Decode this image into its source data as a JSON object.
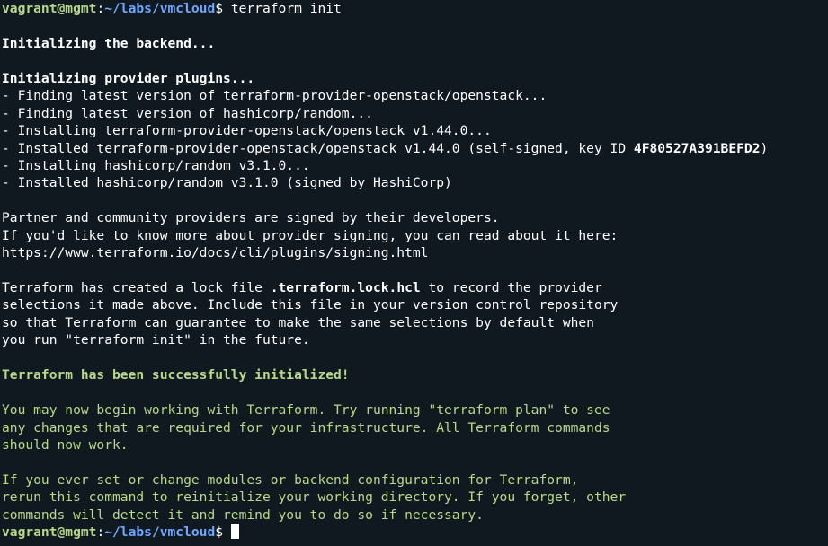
{
  "colors": {
    "background": "#101820",
    "text": "#ffffff",
    "success_green": "#b8d98a",
    "path_blue": "#6ea8ff"
  },
  "prompt": {
    "user_host": "vagrant@mgmt",
    "separator": ":",
    "path": "~/labs/vmcloud",
    "symbol": "$ "
  },
  "command": "terraform init",
  "output": {
    "backend": "Initializing the backend...",
    "providers_heading": "Initializing provider plugins...",
    "find_openstack": "- Finding latest version of terraform-provider-openstack/openstack...",
    "find_random": "- Finding latest version of hashicorp/random...",
    "installing_openstack": "- Installing terraform-provider-openstack/openstack v1.44.0...",
    "installed_openstack_prefix": "- Installed terraform-provider-openstack/openstack v1.44.0 (self-signed, key ID ",
    "installed_openstack_key": "4F80527A391BEFD2",
    "installed_openstack_suffix": ")",
    "installing_random": "- Installing hashicorp/random v3.1.0...",
    "installed_random": "- Installed hashicorp/random v3.1.0 (signed by HashiCorp)",
    "partner_1": "Partner and community providers are signed by their developers.",
    "partner_2": "If you'd like to know more about provider signing, you can read about it here:",
    "partner_3": "https://www.terraform.io/docs/cli/plugins/signing.html",
    "lock_1_prefix": "Terraform has created a lock file ",
    "lock_1_file": ".terraform.lock.hcl",
    "lock_1_suffix": " to record the provider",
    "lock_2": "selections it made above. Include this file in your version control repository",
    "lock_3": "so that Terraform can guarantee to make the same selections by default when",
    "lock_4": "you run \"terraform init\" in the future.",
    "success": "Terraform has been successfully initialized!",
    "next_1": "You may now begin working with Terraform. Try running \"terraform plan\" to see",
    "next_2": "any changes that are required for your infrastructure. All Terraform commands",
    "next_3": "should now work.",
    "reinit_1": "If you ever set or change modules or backend configuration for Terraform,",
    "reinit_2": "rerun this command to reinitialize your working directory. If you forget, other",
    "reinit_3": "commands will detect it and remind you to do so if necessary."
  }
}
